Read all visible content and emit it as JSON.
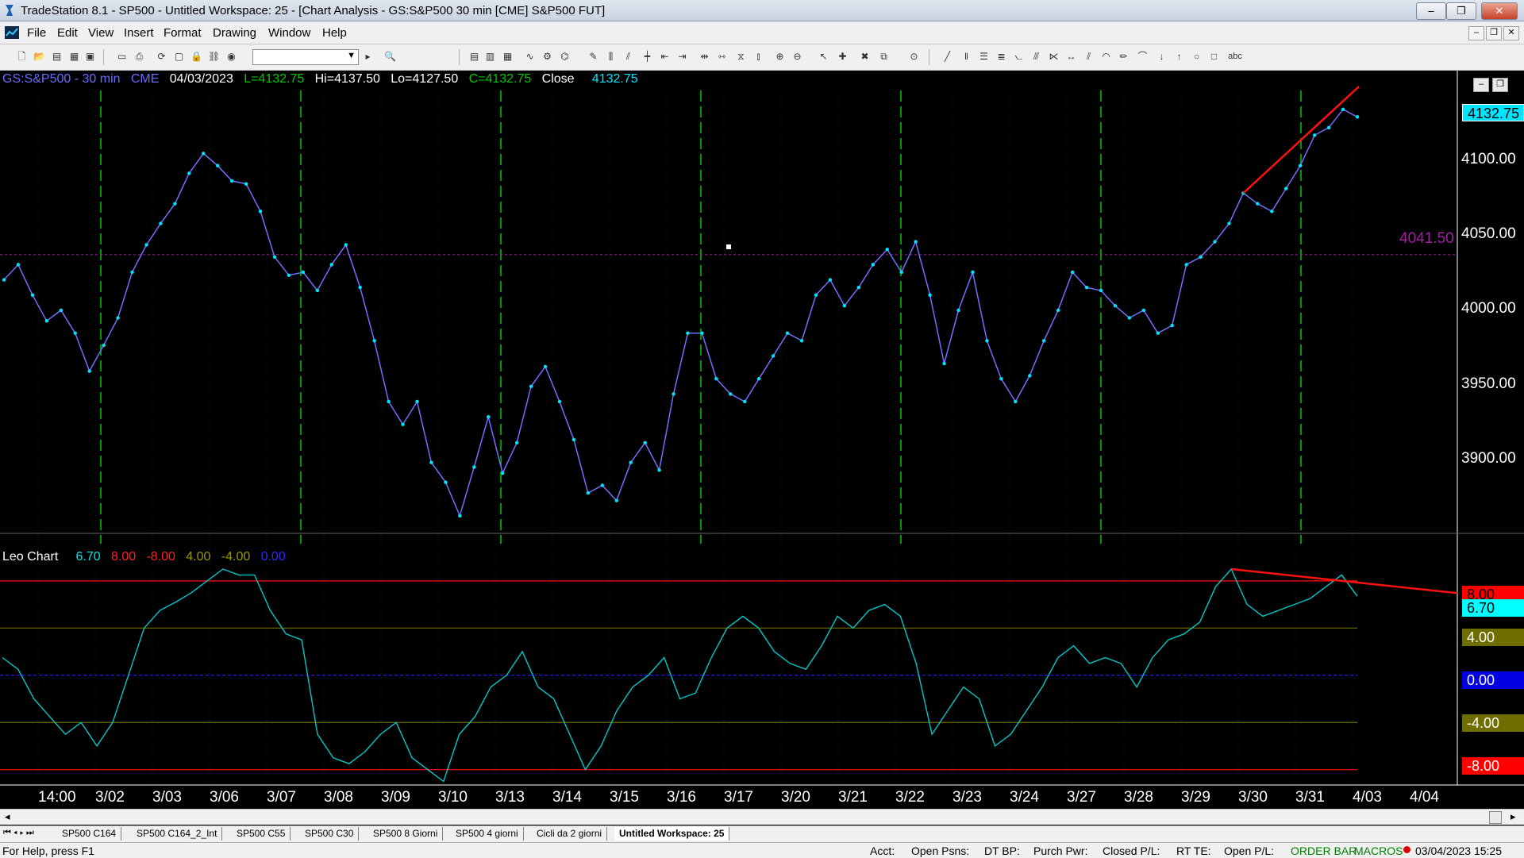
{
  "window": {
    "title": "TradeStation 8.1 - SP500 - Untitled Workspace:  25 - [Chart Analysis - GS:S&P500  30 min  [CME] S&P500 FUT]",
    "min": "–",
    "max": "❐",
    "close": "✕"
  },
  "menu": [
    "File",
    "Edit",
    "View",
    "Insert",
    "Format",
    "Drawing",
    "Window",
    "Help"
  ],
  "mdi_buttons": [
    "–",
    "❐",
    "✕"
  ],
  "price_header": {
    "symbol": "GS:S&P500 - 30 min",
    "exchange": "CME",
    "date": "04/03/2023",
    "last": "L=4132.75",
    "high": "Hi=4137.50",
    "low": "Lo=4127.50",
    "close": "C=4132.75",
    "close_label": "Close",
    "close_value": "4132.75"
  },
  "price_axis": [
    "4100.00",
    "4050.00",
    "4000.00",
    "3950.00",
    "3900.00"
  ],
  "price_marker_last": "4132.75",
  "horizontal_line_label": "4041.50",
  "indicator_header": {
    "name": "Leo Chart",
    "values": [
      {
        "text": "6.70",
        "color": "#00e5e5"
      },
      {
        "text": "8.00",
        "color": "#ff2020"
      },
      {
        "text": "-8.00",
        "color": "#ff2020"
      },
      {
        "text": "4.00",
        "color": "#9a9a00"
      },
      {
        "text": "-4.00",
        "color": "#9a9a00"
      },
      {
        "text": "0.00",
        "color": "#2b2bff"
      }
    ]
  },
  "indicator_axis": [
    {
      "text": "8.00",
      "bg": "#ff0000",
      "fg": "#000000"
    },
    {
      "text": "6.70",
      "bg": "#00ffff",
      "fg": "#000000"
    },
    {
      "text": "4.00",
      "bg": "#6e6e00",
      "fg": "#ffffff"
    },
    {
      "text": "0.00",
      "bg": "#0000e0",
      "fg": "#ffffff"
    },
    {
      "text": "-4.00",
      "bg": "#6e6e00",
      "fg": "#ffffff"
    },
    {
      "text": "-8.00",
      "bg": "#ff0000",
      "fg": "#ffffff"
    }
  ],
  "time_axis": [
    "14:00",
    "3/02",
    "3/03",
    "3/06",
    "3/07",
    "3/08",
    "3/09",
    "3/10",
    "3/13",
    "3/14",
    "3/15",
    "3/16",
    "3/17",
    "3/20",
    "3/21",
    "3/22",
    "3/23",
    "3/24",
    "3/27",
    "3/28",
    "3/29",
    "3/30",
    "3/31",
    "4/03",
    "4/04"
  ],
  "tabs": [
    "SP500 C164",
    "SP500 C164_2_Int",
    "SP500 C55",
    "SP500 C30",
    "SP500 8 Giorni",
    "SP500 4 giorni",
    "Cicli da 2 giorni",
    "Untitled Workspace:  25"
  ],
  "status": {
    "help": "For Help, press F1",
    "acct": "Acct:",
    "open_psns": "Open Psns:",
    "dt_bp": "DT BP:",
    "purch_pwr": "Purch Pwr:",
    "closed_pl": "Closed P/L:",
    "rt_te": "RT TE:",
    "open_pl": "Open P/L:",
    "order_bar": "ORDER BAR",
    "macros": "MACROS",
    "datetime": "03/04/2023 15:25"
  },
  "colors": {
    "price_line": "#7070ff",
    "price_dots": "#00e5ff",
    "cycle_lines": "#00c800",
    "trendline": "#ff1010",
    "osc_line": "#00c8c8"
  },
  "chart_data": {
    "type": "line",
    "price_series": {
      "name": "GS:S&P500 - 30 min",
      "ylim": [
        3860,
        4152
      ],
      "values": [
        4025,
        4035,
        4015,
        3998,
        4005,
        3990,
        3965,
        3982,
        4000,
        4030,
        4048,
        4062,
        4075,
        4095,
        4108,
        4100,
        4090,
        4088,
        4070,
        4040,
        4028,
        4030,
        4018,
        4035,
        4048,
        4020,
        3985,
        3945,
        3930,
        3945,
        3905,
        3892,
        3870,
        3902,
        3935,
        3898,
        3918,
        3955,
        3968,
        3945,
        3920,
        3885,
        3890,
        3880,
        3905,
        3918,
        3900,
        3950,
        3990,
        3990,
        3960,
        3950,
        3945,
        3960,
        3975,
        3990,
        3985,
        4015,
        4025,
        4008,
        4020,
        4035,
        4045,
        4030,
        4050,
        4015,
        3970,
        4005,
        4030,
        3985,
        3960,
        3945,
        3962,
        3985,
        4005,
        4030,
        4020,
        4018,
        4008,
        4000,
        4005,
        3990,
        3995,
        4035,
        4040,
        4050,
        4062,
        4082,
        4075,
        4070,
        4085,
        4100,
        4120,
        4125,
        4137,
        4132
      ]
    },
    "horizontal_line": 4041.5,
    "cycle_line_labels": [
      "3/02",
      "3/07",
      "3/13",
      "3/16",
      "3/22",
      "3/27",
      "3/30"
    ],
    "trendline_price": {
      "from": 4082,
      "to": 4152
    },
    "oscillator": {
      "name": "Leo Chart",
      "ylim": [
        -9.3,
        9.2
      ],
      "levels": [
        8,
        4,
        0,
        -4,
        -8
      ],
      "values": [
        1.5,
        0.5,
        -2,
        -3.5,
        -5,
        -4,
        -6,
        -4,
        0,
        4,
        5.5,
        6.2,
        7,
        8,
        9,
        8.5,
        8.5,
        5.5,
        3.5,
        3,
        -5,
        -7,
        -7.5,
        -6.5,
        -5,
        -4,
        -7,
        -8,
        -9,
        -5,
        -3.5,
        -1,
        0,
        2,
        -1,
        -2,
        -5,
        -8,
        -6,
        -3,
        -1,
        0,
        1.5,
        -2,
        -1.5,
        1.5,
        4,
        5,
        4,
        2,
        1,
        0.5,
        2.5,
        5,
        4,
        5.5,
        6,
        5,
        1,
        -5,
        -3,
        -1,
        -2,
        -6,
        -5,
        -3,
        -1,
        1.5,
        2.5,
        1,
        1.5,
        1,
        -1,
        1.5,
        3,
        3.5,
        4.5,
        7.5,
        9,
        6,
        5,
        5.5,
        6,
        6.5,
        7.5,
        8.5,
        6.7
      ],
      "trendline": {
        "from": 9,
        "to": 7.5
      }
    }
  }
}
